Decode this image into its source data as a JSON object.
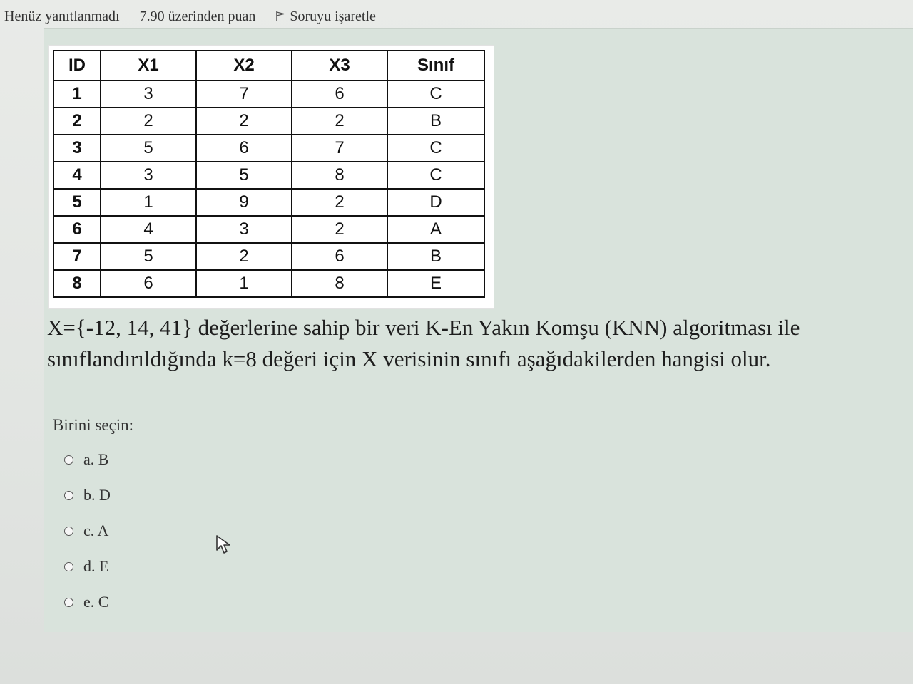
{
  "status": {
    "answer_state": "Henüz yanıtlanmadı",
    "points": "7.90 üzerinden puan",
    "flag_label": "Soruyu işaretle"
  },
  "table": {
    "headers": [
      "ID",
      "X1",
      "X2",
      "X3",
      "Sınıf"
    ],
    "rows": [
      [
        "1",
        "3",
        "7",
        "6",
        "C"
      ],
      [
        "2",
        "2",
        "2",
        "2",
        "B"
      ],
      [
        "3",
        "5",
        "6",
        "7",
        "C"
      ],
      [
        "4",
        "3",
        "5",
        "8",
        "C"
      ],
      [
        "5",
        "1",
        "9",
        "2",
        "D"
      ],
      [
        "6",
        "4",
        "3",
        "2",
        "A"
      ],
      [
        "7",
        "5",
        "2",
        "6",
        "B"
      ],
      [
        "8",
        "6",
        "1",
        "8",
        "E"
      ]
    ]
  },
  "question": {
    "line1": "X={-12, 14, 41} değerlerine sahip bir veri K-En Yakın Komşu (KNN) algoritması ile",
    "line2": "sınıflandırıldığında k=8 değeri için X verisinin sınıfı aşağıdakilerden hangisi olur."
  },
  "answers": {
    "prompt": "Birini seçin:",
    "options": [
      "a. B",
      "b. D",
      "c. A",
      "d. E",
      "e. C"
    ]
  },
  "icons": {
    "flag": "flag-icon",
    "radio": "radio-unchecked-icon",
    "cursor": "mouse-pointer-icon"
  }
}
